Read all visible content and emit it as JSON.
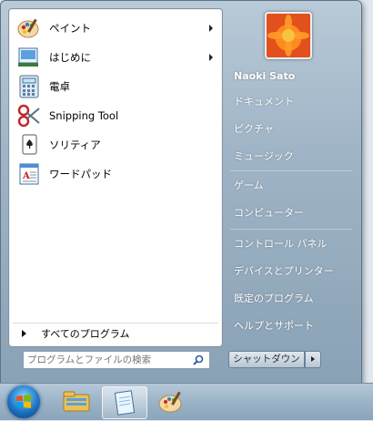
{
  "programs": [
    {
      "label": "ペイント",
      "icon": "paint-palette-icon",
      "has_submenu": true
    },
    {
      "label": "はじめに",
      "icon": "getting-started-icon",
      "has_submenu": true
    },
    {
      "label": "電卓",
      "icon": "calculator-icon",
      "has_submenu": false
    },
    {
      "label": "Snipping Tool",
      "icon": "scissors-icon",
      "has_submenu": false
    },
    {
      "label": "ソリティア",
      "icon": "solitaire-icon",
      "has_submenu": false
    },
    {
      "label": "ワードパッド",
      "icon": "wordpad-icon",
      "has_submenu": false
    }
  ],
  "all_programs_label": "すべてのプログラム",
  "search": {
    "placeholder": "プログラムとファイルの検索",
    "value": ""
  },
  "user": {
    "name": "Naoki Sato"
  },
  "right_items": [
    "ドキュメント",
    "ピクチャ",
    "ミュージック",
    "ゲーム",
    "コンピューター",
    "コントロール パネル",
    "デバイスとプリンター",
    "既定のプログラム",
    "ヘルプとサポート"
  ],
  "shutdown_label": "シャットダウン",
  "taskbar": {
    "items": [
      {
        "name": "file-explorer-icon"
      },
      {
        "name": "notepad-icon"
      },
      {
        "name": "paint-taskbar-icon"
      }
    ]
  },
  "colors": {
    "accent": "#1d74c4",
    "panel": "#9fb4c6"
  }
}
